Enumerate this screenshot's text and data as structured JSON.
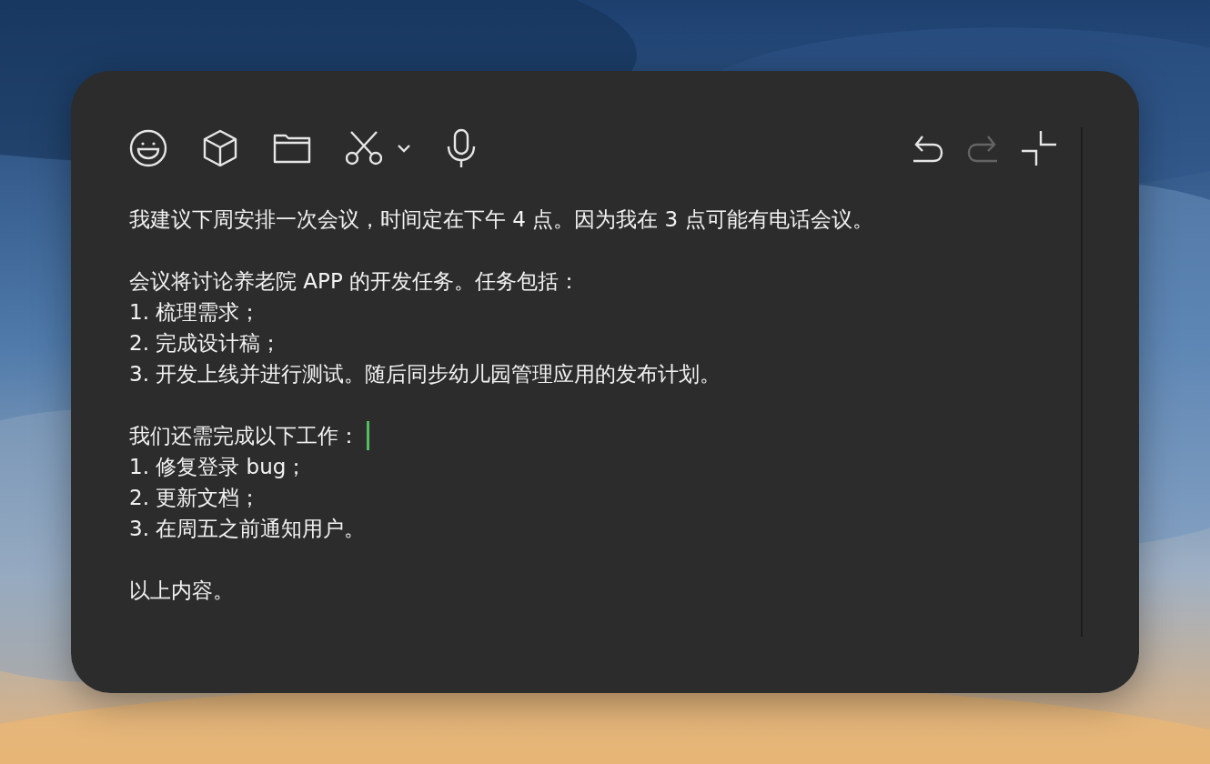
{
  "toolbar": {
    "left": [
      {
        "kind": "emoji"
      },
      {
        "kind": "box"
      },
      {
        "kind": "folder"
      },
      {
        "kind": "scissors"
      },
      {
        "kind": "caret"
      },
      {
        "kind": "mic"
      }
    ],
    "right": [
      {
        "kind": "undo",
        "disabled": false
      },
      {
        "kind": "redo",
        "disabled": true
      },
      {
        "kind": "collapse"
      }
    ]
  },
  "paragraphs": [
    {
      "lines": [
        {
          "text": "我建议下周安排一次会议，时间定在下午 4 点。因为我在 3 点可能有电话会议。",
          "cursor": false
        }
      ]
    },
    {
      "lines": [
        {
          "text": "会议将讨论养老院 APP 的开发任务。任务包括：",
          "cursor": false
        },
        {
          "text": "1. 梳理需求；",
          "cursor": false
        },
        {
          "text": "2. 完成设计稿；",
          "cursor": false
        },
        {
          "text": "3. 开发上线并进行测试。随后同步幼儿园管理应用的发布计划。",
          "cursor": false
        }
      ]
    },
    {
      "lines": [
        {
          "text": "我们还需完成以下工作：",
          "cursor": true
        },
        {
          "text": "1. 修复登录 bug；",
          "cursor": false
        },
        {
          "text": "2. 更新文档；",
          "cursor": false
        },
        {
          "text": "3. 在周五之前通知用户。",
          "cursor": false
        }
      ]
    },
    {
      "lines": [
        {
          "text": "以上内容。",
          "cursor": false
        }
      ]
    }
  ]
}
